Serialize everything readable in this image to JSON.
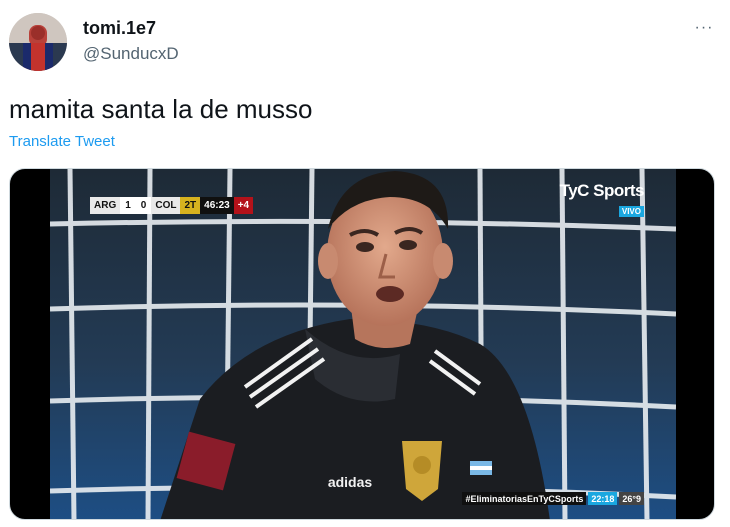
{
  "author": {
    "display_name": "tomi.1e7",
    "handle": "@SunducxD"
  },
  "tweet": {
    "text": "mamita santa la de musso",
    "translate_label": "Translate Tweet",
    "more_icon": "···"
  },
  "media": {
    "scoreboard": {
      "home_team": "ARG",
      "home_score": "1",
      "away_score": "0",
      "away_team": "COL",
      "period": "2T",
      "clock": "46:23",
      "added_time": "+4"
    },
    "broadcaster": {
      "name": "TyC Sports",
      "live_badge": "VIVO"
    },
    "ticker": {
      "hashtag": "#EliminatoriasEnTyCSports",
      "time": "22:18",
      "temperature": "26°9"
    },
    "jersey_brand": "adidas"
  },
  "colors": {
    "link": "#1d9bf0",
    "handle": "#536471",
    "text": "#0f1419"
  }
}
